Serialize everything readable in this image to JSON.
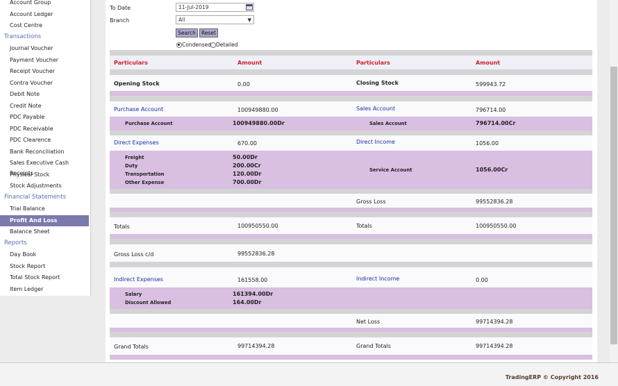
{
  "sidebar": {
    "items": [
      {
        "label": "Account Group",
        "type": "item",
        "active": false
      },
      {
        "label": "Account Ledger",
        "type": "item",
        "active": false
      },
      {
        "label": "Cost Centre",
        "type": "item",
        "active": false
      },
      {
        "label": "Transactions",
        "type": "heading",
        "active": false
      },
      {
        "label": "Journal Voucher",
        "type": "item",
        "active": false
      },
      {
        "label": "Payment Voucher",
        "type": "item",
        "active": false
      },
      {
        "label": "Receipt Voucher",
        "type": "item",
        "active": false
      },
      {
        "label": "Contra Voucher",
        "type": "item",
        "active": false
      },
      {
        "label": "Debit Note",
        "type": "item",
        "active": false
      },
      {
        "label": "Credit Note",
        "type": "item",
        "active": false
      },
      {
        "label": "PDC Payable",
        "type": "item",
        "active": false
      },
      {
        "label": "PDC Receivable",
        "type": "item",
        "active": false
      },
      {
        "label": "PDC Clearence",
        "type": "item",
        "active": false
      },
      {
        "label": "Bank Reconciliation",
        "type": "item",
        "active": false
      },
      {
        "label": "Sales Executive Cash Receipts",
        "type": "item",
        "active": false
      },
      {
        "label": "Physical Stock",
        "type": "item",
        "active": false
      },
      {
        "label": "Stock Adjustments",
        "type": "item",
        "active": false
      },
      {
        "label": "Financial Statements",
        "type": "heading",
        "active": false
      },
      {
        "label": "Trial Balance",
        "type": "item",
        "active": false
      },
      {
        "label": "Profit And Loss",
        "type": "item",
        "active": true
      },
      {
        "label": "Balance Sheet",
        "type": "item",
        "active": false
      },
      {
        "label": "Reports",
        "type": "heading",
        "active": false
      },
      {
        "label": "Day Book",
        "type": "item",
        "active": false
      },
      {
        "label": "Stock Report",
        "type": "item",
        "active": false
      },
      {
        "label": "Total Stock Report",
        "type": "item",
        "active": false
      },
      {
        "label": "Item Ledger",
        "type": "item",
        "active": false
      }
    ]
  },
  "filters": {
    "to_date_label": "To Date",
    "to_date_value": "11-Jul-2019",
    "branch_label": "Branch",
    "branch_value": "All",
    "search_label": "Search",
    "reset_label": "Reset",
    "condensed_label": "Condensed",
    "detailed_label": "Detailed",
    "view_mode": "Condensed"
  },
  "report": {
    "header": {
      "particulars_left": "Particulars",
      "amount_left": "Amount",
      "particulars_right": "Particulars",
      "amount_right": "Amount"
    },
    "opening_stock": {
      "label": "Opening Stock",
      "amount": "0.00"
    },
    "closing_stock": {
      "label": "Closing Stock",
      "amount": "599943.72"
    },
    "purchase_account": {
      "label": "Purchase Account",
      "amount": "100949880.00",
      "detail_label": "Purchase Account",
      "detail_amount": "100949880.00Dr"
    },
    "sales_account": {
      "label": "Sales Account",
      "amount": "796714.00",
      "detail_label": "Sales Account",
      "detail_amount": "796714.00Cr"
    },
    "direct_expenses": {
      "label": "Direct Expenses",
      "amount": "670.00",
      "details": [
        {
          "label": "Freight",
          "amount": "50.00Dr"
        },
        {
          "label": "Duty",
          "amount": "200.00Cr"
        },
        {
          "label": "Transportation",
          "amount": "120.00Dr"
        },
        {
          "label": "Other Expense",
          "amount": "700.00Dr"
        }
      ]
    },
    "direct_income": {
      "label": "Direct Income",
      "amount": "1056.00",
      "detail_label": "Service Account",
      "detail_amount": "1056.00Cr"
    },
    "gross_loss": {
      "label": "Gross Loss",
      "amount": "99552836.28"
    },
    "totals": {
      "left_label": "Totals",
      "left_amount": "100950550.00",
      "right_label": "Totals",
      "right_amount": "100950550.00"
    },
    "gross_loss_cd": {
      "label": "Gross Loss c/d",
      "amount": "99552836.28"
    },
    "indirect_expenses": {
      "label": "Indirect Expenses",
      "amount": "161558.00",
      "details": [
        {
          "label": "Salary",
          "amount": "161394.00Dr"
        },
        {
          "label": "Discount Allowed",
          "amount": "164.00Dr"
        }
      ]
    },
    "indirect_income": {
      "label": "Indirect Income",
      "amount": "0.00"
    },
    "net_loss": {
      "label": "Net Loss",
      "amount": "99714394.28"
    },
    "grand_totals": {
      "left_label": "Grand Totals",
      "left_amount": "99714394.28",
      "right_label": "Grand Totals",
      "right_amount": "99714394.28"
    }
  },
  "footer": {
    "copyright": "TradingERP © Copyright 2016"
  }
}
